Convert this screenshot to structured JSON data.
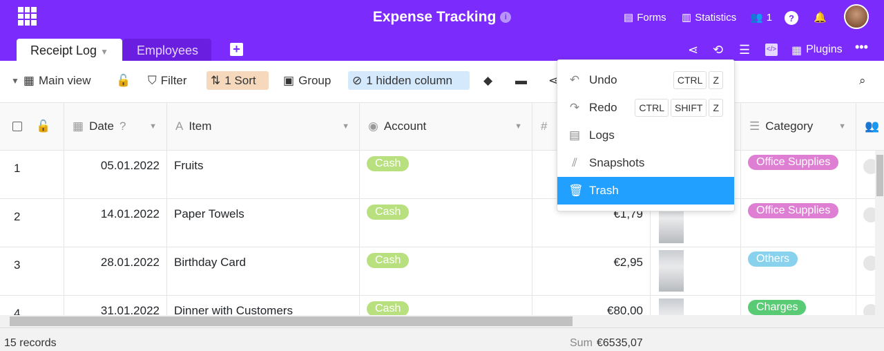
{
  "header": {
    "title": "Expense Tracking",
    "forms": "Forms",
    "statistics": "Statistics",
    "collaborators": "1"
  },
  "tabs": [
    {
      "label": "Receipt Log"
    },
    {
      "label": "Employees"
    }
  ],
  "toolbar": {
    "view": "Main view",
    "filter": "Filter",
    "sort": "1 Sort",
    "group": "Group",
    "hidden": "1 hidden column",
    "plugins": "Plugins"
  },
  "columns": {
    "date": "Date",
    "item": "Item",
    "account": "Account",
    "category": "Category"
  },
  "rows": [
    {
      "n": "1",
      "date": "05.01.2022",
      "item": "Fruits",
      "account": "Cash",
      "amount": "",
      "category": "Office Supplies",
      "cat_color": "#de7fd3"
    },
    {
      "n": "2",
      "date": "14.01.2022",
      "item": "Paper Towels",
      "account": "Cash",
      "amount": "€1,79",
      "category": "Office Supplies",
      "cat_color": "#de7fd3"
    },
    {
      "n": "3",
      "date": "28.01.2022",
      "item": "Birthday Card",
      "account": "Cash",
      "amount": "€2,95",
      "category": "Others",
      "cat_color": "#89d2ee"
    },
    {
      "n": "4",
      "date": "31.01.2022",
      "item": "Dinner with Customers",
      "account": "Cash",
      "amount": "€80,00",
      "category": "Charges",
      "cat_color": "#59cb74"
    }
  ],
  "menu": {
    "undo": "Undo",
    "redo": "Redo",
    "logs": "Logs",
    "snapshots": "Snapshots",
    "trash": "Trash",
    "ctrl": "CTRL",
    "shift": "SHIFT",
    "z": "Z"
  },
  "footer": {
    "records": "15 records",
    "sum_label": "Sum",
    "sum_value": "€6535,07"
  },
  "colors": {
    "brand": "#7b2bfb",
    "highlight": "#22a0ff",
    "account_pill": "#b8e07f"
  }
}
